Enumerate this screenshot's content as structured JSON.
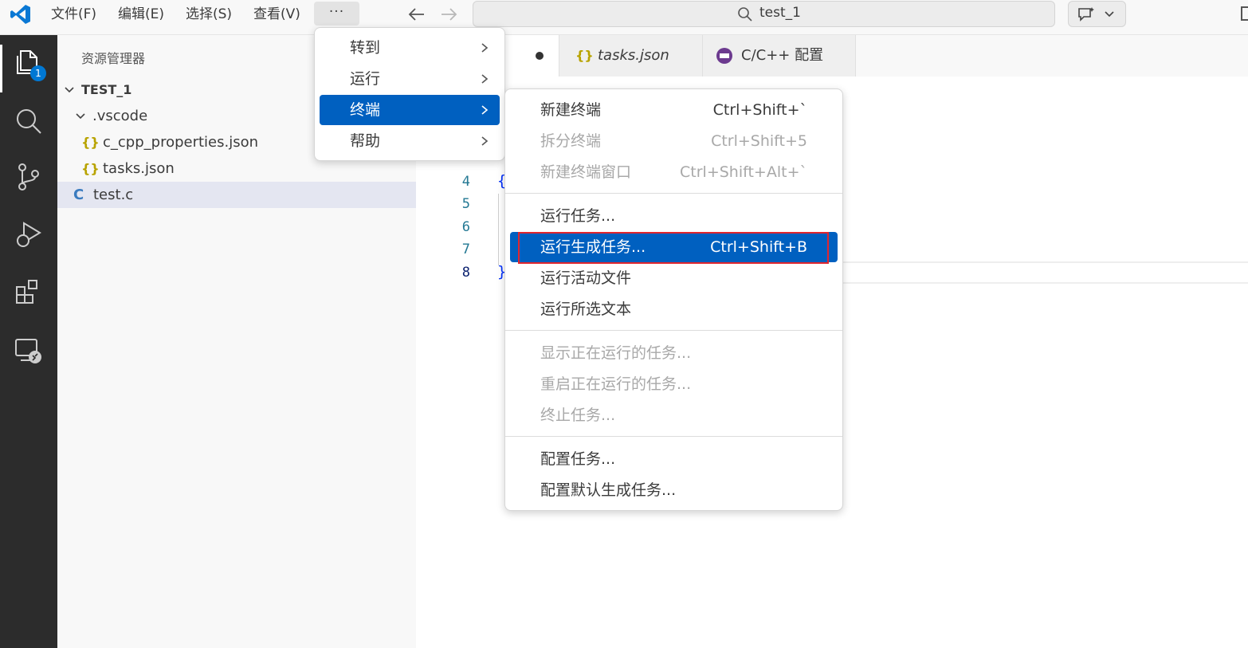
{
  "titlebar": {
    "menus": [
      "文件(F)",
      "编辑(E)",
      "选择(S)",
      "查看(V)"
    ],
    "more_label": "···",
    "search_text": "test_1"
  },
  "activity": {
    "explorer_badge": "1"
  },
  "sidebar": {
    "title": "资源管理器",
    "workspace": "TEST_1",
    "folder": ".vscode",
    "files": [
      "c_cpp_properties.json",
      "tasks.json"
    ],
    "selected_file": "test.c",
    "json_glyph": "{}",
    "c_glyph": "C"
  },
  "tabs": [
    {
      "label": "tasks.json",
      "glyph": "{}"
    },
    {
      "label": "C/C++ 配置"
    }
  ],
  "editor": {
    "line_numbers": [
      "4",
      "5",
      "6",
      "7",
      "8"
    ],
    "open_brace": "{",
    "close_brace": "}"
  },
  "menu_more": {
    "items": [
      "转到",
      "运行",
      "终端",
      "帮助"
    ],
    "highlighted": "终端"
  },
  "menu_terminal": {
    "group1": [
      {
        "label": "新建终端",
        "shortcut": "Ctrl+Shift+`"
      },
      {
        "label": "拆分终端",
        "shortcut": "Ctrl+Shift+5"
      },
      {
        "label": "新建终端窗口",
        "shortcut": "Ctrl+Shift+Alt+`"
      }
    ],
    "group2": [
      {
        "label": "运行任务..."
      },
      {
        "label": "运行生成任务...",
        "shortcut": "Ctrl+Shift+B"
      },
      {
        "label": "运行活动文件"
      },
      {
        "label": "运行所选文本"
      }
    ],
    "group3": [
      {
        "label": "显示正在运行的任务..."
      },
      {
        "label": "重启正在运行的任务..."
      },
      {
        "label": "终止任务..."
      }
    ],
    "group4": [
      {
        "label": "配置任务..."
      },
      {
        "label": "配置默认生成任务..."
      }
    ]
  },
  "colors": {
    "highlight": "#0060c0",
    "annotation": "#e0262e"
  }
}
